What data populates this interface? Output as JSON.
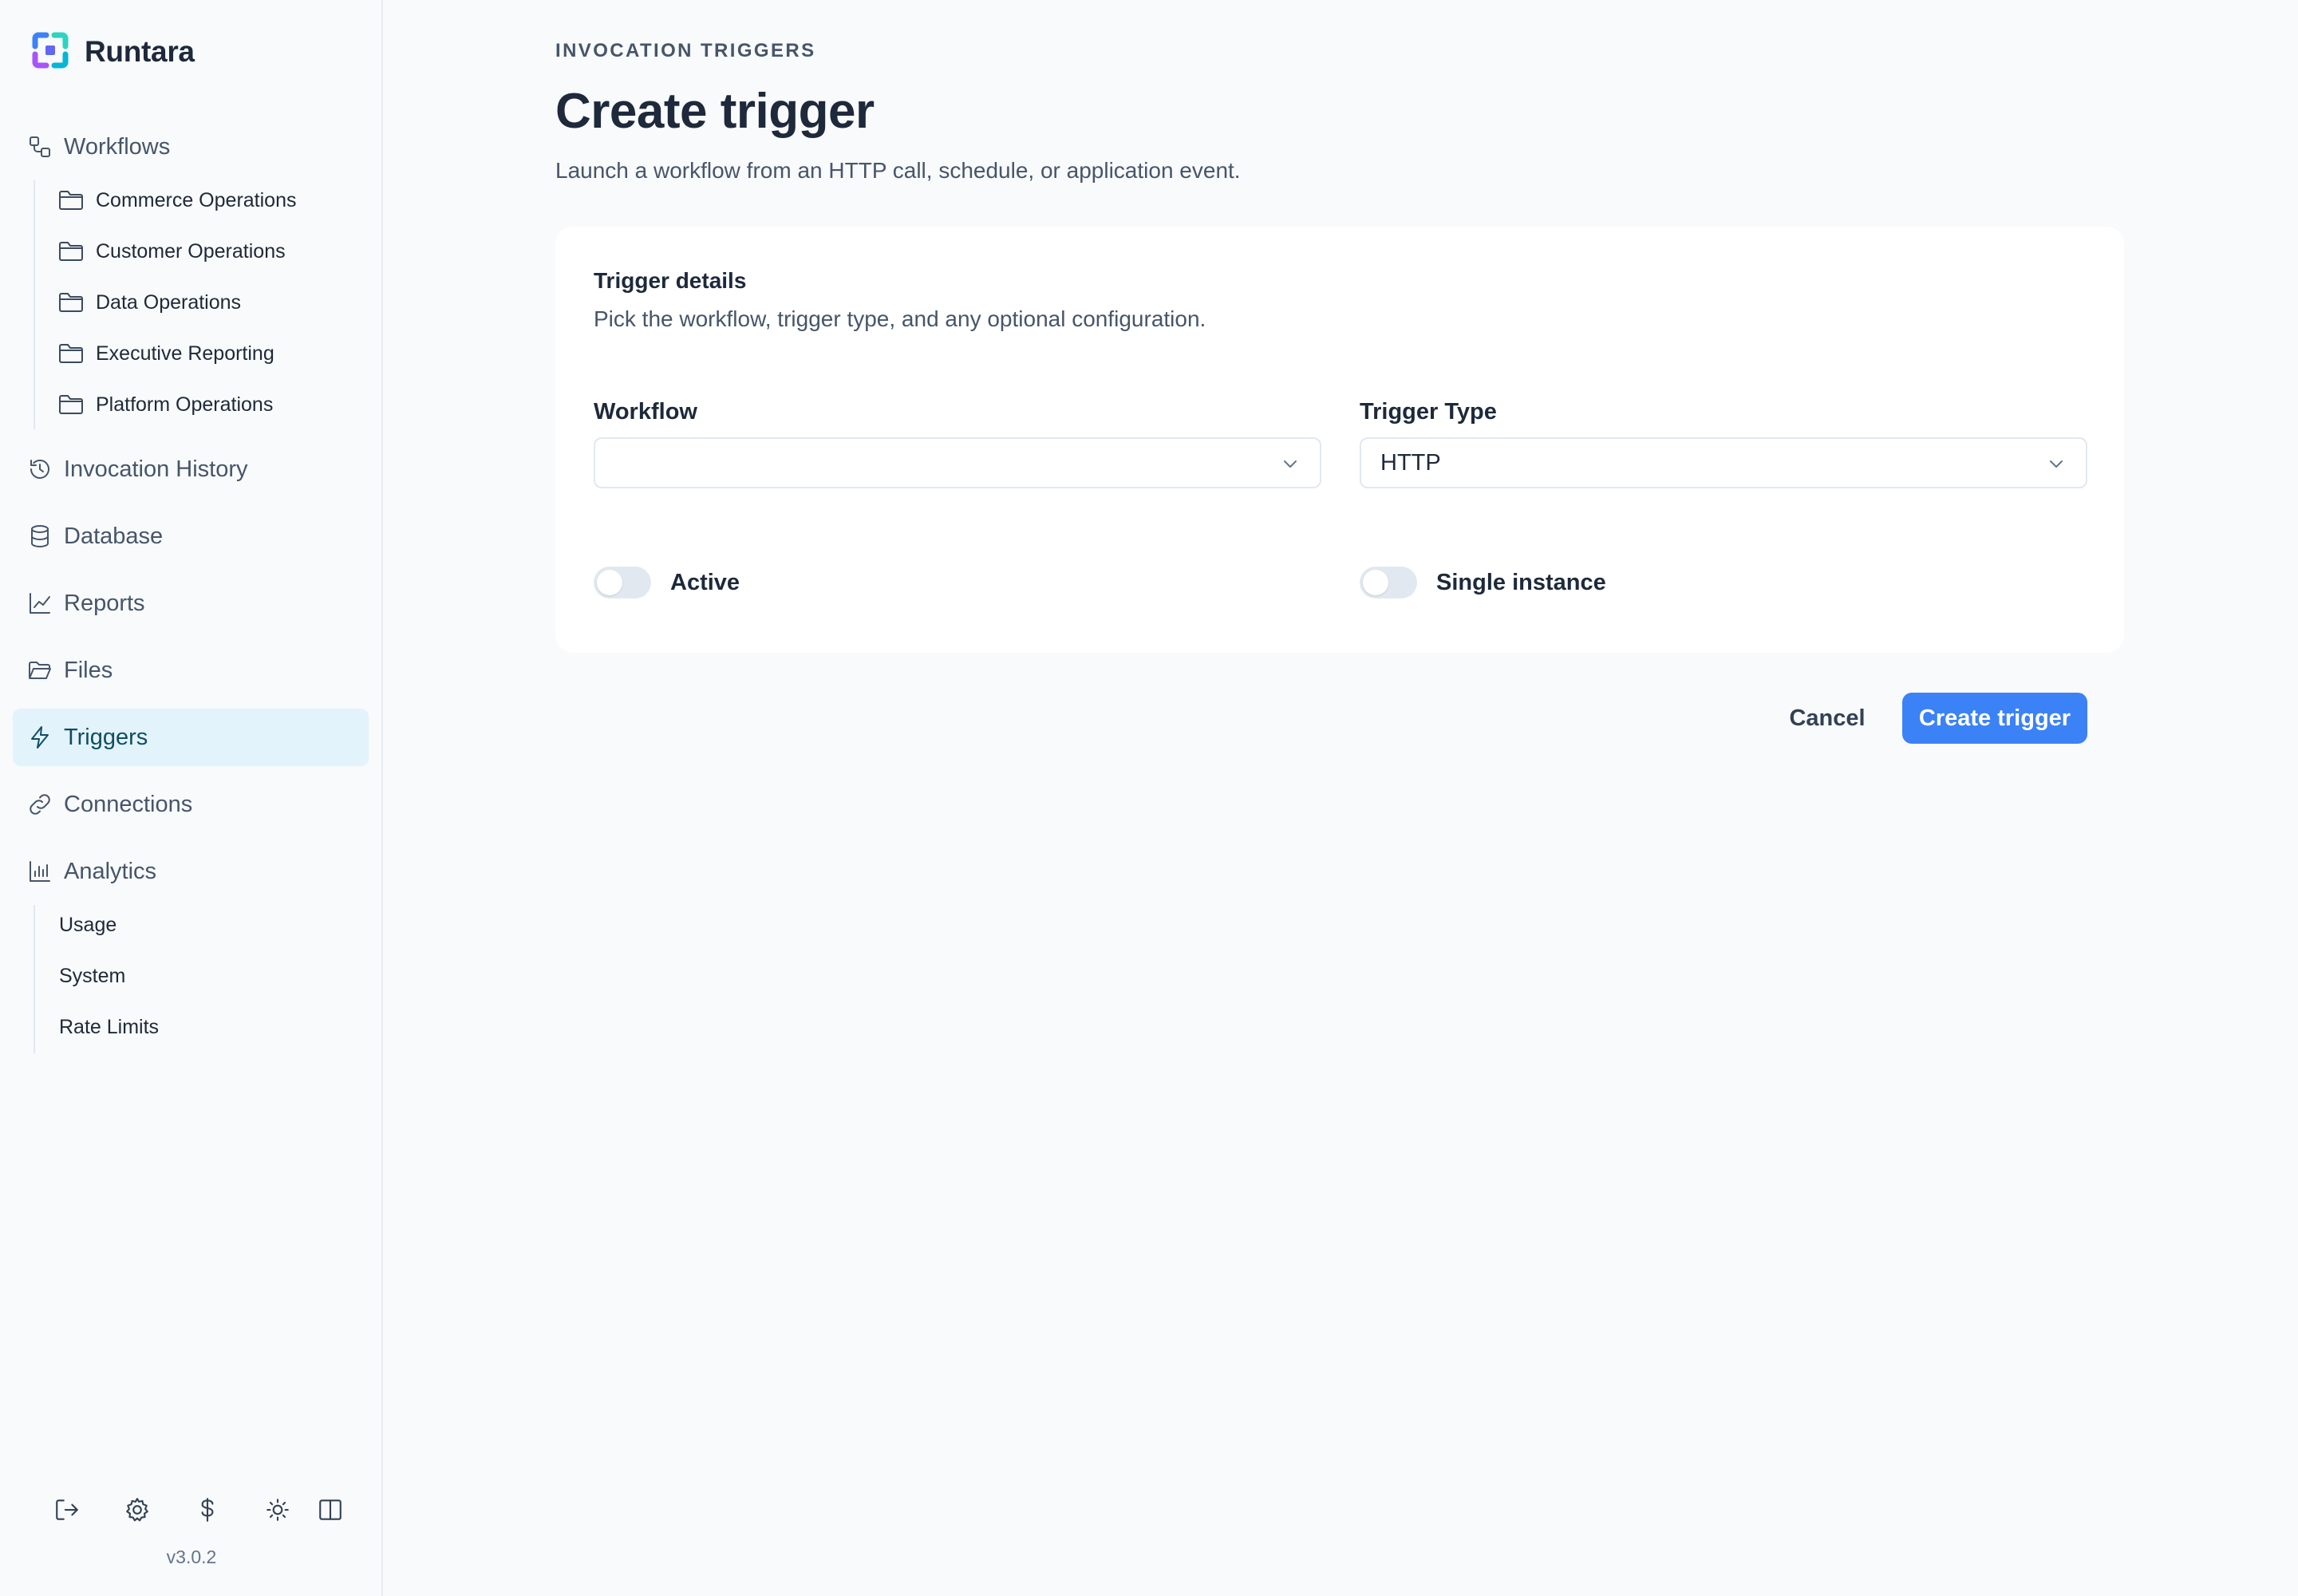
{
  "app": {
    "name": "Runtara",
    "version": "v3.0.2"
  },
  "sidebar": {
    "workflows": {
      "label": "Workflows",
      "folders": [
        "Commerce Operations",
        "Customer Operations",
        "Data Operations",
        "Executive Reporting",
        "Platform Operations"
      ]
    },
    "items": {
      "invocation_history": "Invocation History",
      "database": "Database",
      "reports": "Reports",
      "files": "Files",
      "triggers": "Triggers",
      "connections": "Connections",
      "analytics": "Analytics"
    },
    "active_item": "Triggers",
    "analytics_children": [
      "Usage",
      "System",
      "Rate Limits"
    ],
    "bottom_icons": [
      "logout-icon",
      "settings-icon",
      "billing-icon",
      "theme-icon",
      "layout-toggle-icon"
    ]
  },
  "page": {
    "eyebrow": "INVOCATION TRIGGERS",
    "title": "Create trigger",
    "subtitle": "Launch a workflow from an HTTP call, schedule, or application event."
  },
  "card": {
    "title": "Trigger details",
    "subtitle": "Pick the workflow, trigger type, and any optional configuration.",
    "workflow": {
      "label": "Workflow",
      "value": ""
    },
    "trigger_type": {
      "label": "Trigger Type",
      "value": "HTTP"
    },
    "active": {
      "label": "Active",
      "on": false
    },
    "single_instance": {
      "label": "Single instance",
      "on": false
    }
  },
  "actions": {
    "cancel": "Cancel",
    "create": "Create trigger"
  },
  "colors": {
    "accent": "#3b82f6",
    "active_nav_bg": "#e3f3fb",
    "active_nav_text": "#0e4e63",
    "background": "#f8fafc"
  }
}
